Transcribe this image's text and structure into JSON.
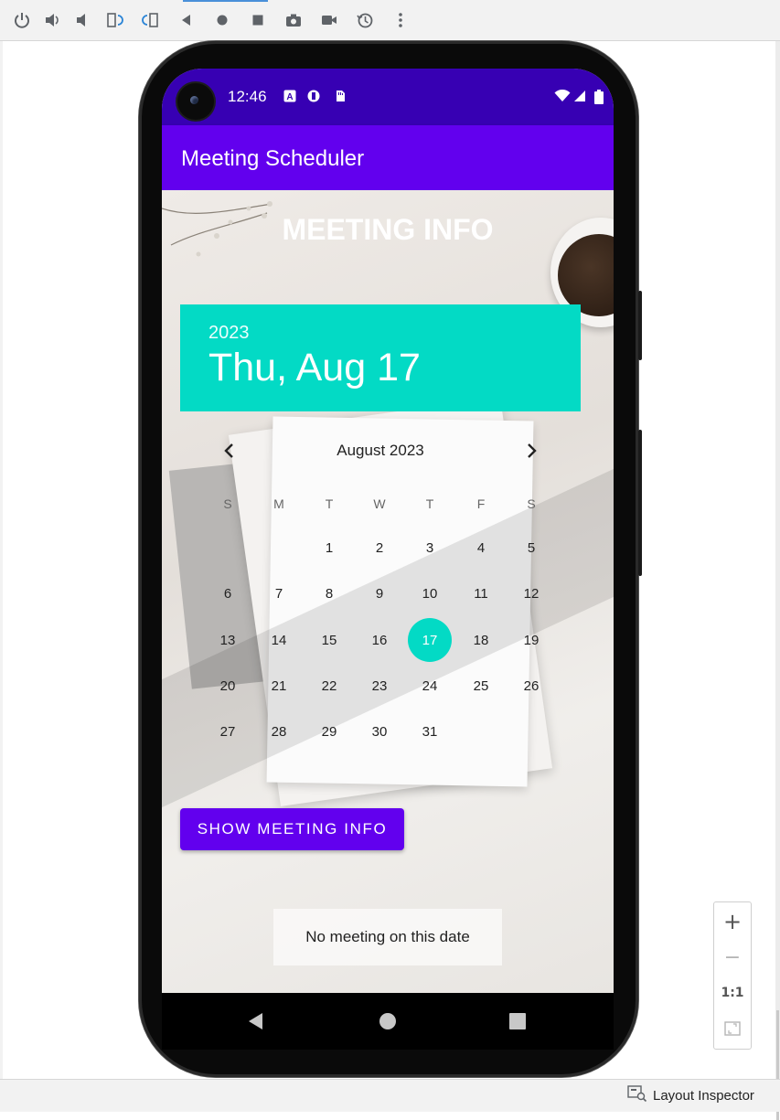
{
  "toolbar": {
    "icons": [
      "power-icon",
      "volume-up-icon",
      "volume-down-icon",
      "rotate-left-icon",
      "rotate-right-icon",
      "back-icon",
      "home-icon",
      "overview-icon",
      "screenshot-icon",
      "screen-record-icon",
      "snapshot-icon",
      "more-icon"
    ]
  },
  "status_bar": {
    "time": "12:46"
  },
  "app_bar": {
    "title": "Meeting Scheduler"
  },
  "content": {
    "heading": "MEETING INFO",
    "date_picker": {
      "year": "2023",
      "selected_date": "Thu, Aug 17",
      "month_label": "August 2023",
      "weekdays": [
        "S",
        "M",
        "T",
        "W",
        "T",
        "F",
        "S"
      ],
      "weeks": [
        [
          "",
          "",
          "1",
          "2",
          "3",
          "4",
          "5"
        ],
        [
          "6",
          "7",
          "8",
          "9",
          "10",
          "11",
          "12"
        ],
        [
          "13",
          "14",
          "15",
          "16",
          "17",
          "18",
          "19"
        ],
        [
          "20",
          "21",
          "22",
          "23",
          "24",
          "25",
          "26"
        ],
        [
          "27",
          "28",
          "29",
          "30",
          "31",
          "",
          ""
        ]
      ],
      "selected_day": "17"
    },
    "show_button": "SHOW MEETING INFO",
    "status_message": "No meeting on this date"
  },
  "zoom_panel": {
    "zoom_in": "+",
    "zoom_out": "−",
    "actual_size": "1:1"
  },
  "bottom_bar": {
    "layout_inspector": "Layout Inspector"
  },
  "colors": {
    "status_bar": "#3700b3",
    "app_bar": "#6200ee",
    "accent": "#03dac5",
    "button": "#6200ee"
  }
}
